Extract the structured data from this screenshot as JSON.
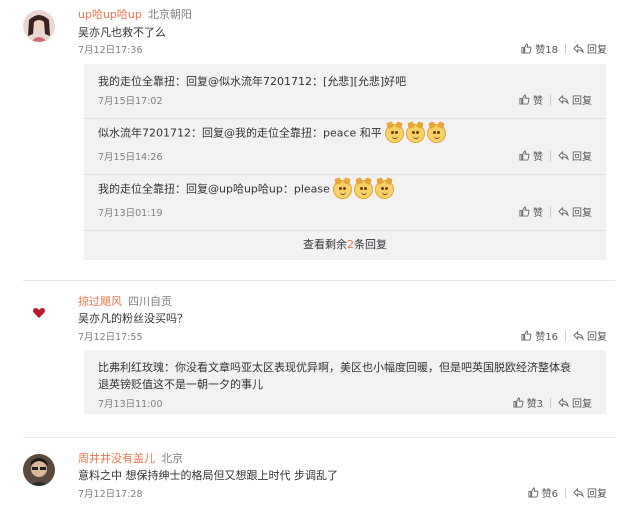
{
  "comments": [
    {
      "username": "up哈up哈up",
      "location": "北京朝阳",
      "text": "吴亦凡也救不了么",
      "time": "7月12日17:36",
      "like_label": "赞18",
      "reply_label": "回复",
      "replies": [
        {
          "text": "我的走位全靠扭：回复@似水流年7201712：[允悲][允悲]好吧",
          "time": "7月15日17:02",
          "like_label": "赞",
          "reply_label": "回复"
        },
        {
          "text": "似水流年7201712：回复@我的走位全靠扭：peace 和平",
          "emoji_count": 3,
          "time": "7月15日14:26",
          "like_label": "赞",
          "reply_label": "回复"
        },
        {
          "text": "我的走位全靠扭：回复@up哈up哈up：please",
          "emoji_count": 3,
          "time": "7月13日01:19",
          "like_label": "赞",
          "reply_label": "回复"
        }
      ],
      "more_prefix": "查看剩余",
      "more_count": "2",
      "more_suffix": "条回复"
    },
    {
      "username": "掠过飓风",
      "location": "四川自贡",
      "text": "吴亦凡的粉丝没买吗？",
      "time": "7月12日17:55",
      "like_label": "赞16",
      "reply_label": "回复",
      "replies": [
        {
          "text_line1": "比弗利红玫瑰：你没看文章吗亚太区表现优异啊，美区也小幅度回暖，但是吧英国脱欧经济整体衰",
          "text_line2": "退英镑贬值这不是一朝一夕的事儿",
          "time": "7月13日11:00",
          "like_label": "赞3",
          "reply_label": "回复"
        }
      ]
    },
    {
      "username": "周井井没有盖儿",
      "location": "北京",
      "text": "意料之中 想保持绅士的格局但又想跟上时代 步调乱了",
      "time": "7月12日17:28",
      "like_label": "赞6",
      "reply_label": "回复"
    }
  ],
  "colors": {
    "username": "#eb7350",
    "reply_bg": "#f2f2f5"
  },
  "icons": {
    "like": "thumbs-up-icon",
    "reply": "reply-arrow-icon"
  }
}
